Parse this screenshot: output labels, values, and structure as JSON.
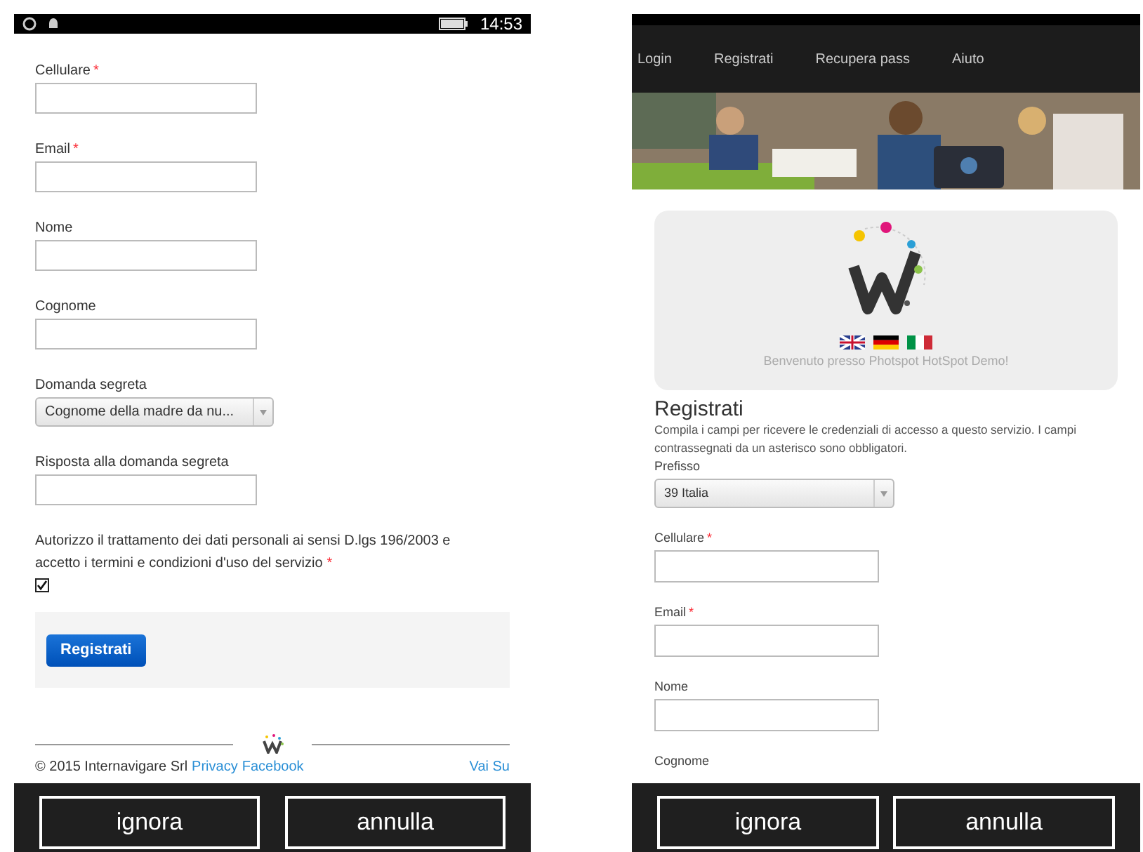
{
  "screens": [
    {
      "status_bar": {
        "time": "14:53"
      },
      "fields": [
        {
          "kind": "text",
          "label": "Cellulare",
          "required_mark": "*"
        },
        {
          "kind": "text",
          "label": "Email",
          "required_mark": "*"
        },
        {
          "kind": "text",
          "label": "Nome"
        },
        {
          "kind": "text",
          "label": "Cognome"
        },
        {
          "kind": "select",
          "label": "Domanda segreta",
          "value": "Cognome della madre da nu..."
        },
        {
          "kind": "text",
          "label": "Risposta alla domanda segreta"
        }
      ],
      "consent": {
        "text": "Autorizzo il trattamento dei dati personali ai sensi D.lgs 196/2003 e accetto i termini e condizioni d'uso del servizio",
        "required_mark": "*",
        "checked": true
      },
      "submit_button": "Registrati",
      "footer": {
        "copyright": "© 2015 Internavigare Srl",
        "links": [
          "Privacy",
          "Facebook"
        ],
        "back_to_top": "Vai Su"
      },
      "bottom_buttons": [
        "ignora",
        "annulla"
      ]
    },
    {
      "nav": [
        {
          "label": "Login"
        },
        {
          "label": "Registrati"
        },
        {
          "label": "Recupera pass"
        },
        {
          "label": "Aiuto"
        }
      ],
      "banner": {
        "kind": "picture"
      },
      "welcome": "Benvenuto presso Photspot HotSpot Demo!",
      "heading": "Registrati",
      "intro": "Compila i campi per ricevere le credenziali di accesso a questo servizio. I campi contrassegnati da un asterisco sono obbligatori.",
      "fields": [
        {
          "kind": "select",
          "label": "Prefisso",
          "value": "39 Italia"
        },
        {
          "kind": "text",
          "label": "Cellulare",
          "required_mark": "*"
        },
        {
          "kind": "text",
          "label": "Email",
          "required_mark": "*"
        },
        {
          "kind": "text",
          "label": "Nome"
        },
        {
          "kind": "label",
          "label": "Cognome"
        }
      ],
      "bottom_buttons": [
        "ignora",
        "annulla"
      ]
    }
  ]
}
